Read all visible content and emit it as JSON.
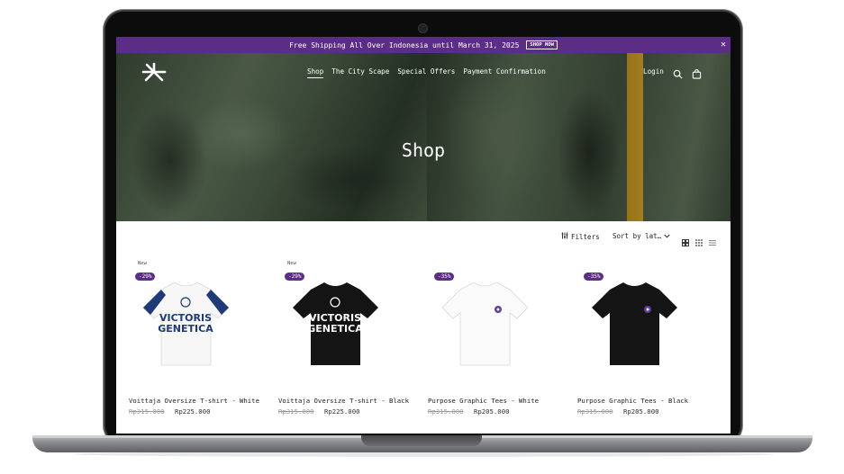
{
  "promo": {
    "text": "Free Shipping All Over Indonesia until March 31, 2025",
    "cta": "SHOP NOW",
    "close": "✕"
  },
  "nav": {
    "items": [
      "Shop",
      "The City Scape",
      "Special Offers",
      "Payment Confirmation"
    ],
    "login": "Login"
  },
  "hero": {
    "title": "Shop"
  },
  "toolbar": {
    "filters": "Filters",
    "sort": "Sort by lat…"
  },
  "products": [
    {
      "badge_new": "New",
      "discount": "-29%",
      "name": "Voittaja Oversize T-shirt - White",
      "old_price": "Rp315.000",
      "price": "Rp225.000",
      "color": "white",
      "print": [
        "VICTORIS",
        "GENETICA"
      ]
    },
    {
      "badge_new": "New",
      "discount": "-29%",
      "name": "Voittaja Oversize T-shirt - Black",
      "old_price": "Rp315.000",
      "price": "Rp225.000",
      "color": "black",
      "print": [
        "VICTORIS",
        "GENETICA"
      ]
    },
    {
      "badge_new": "",
      "discount": "-35%",
      "name": "Purpose Graphic Tees - White",
      "old_price": "Rp315.000",
      "price": "Rp205.000",
      "color": "white",
      "print": []
    },
    {
      "badge_new": "",
      "discount": "-35%",
      "name": "Purpose Graphic Tees - Black",
      "old_price": "Rp315.000",
      "price": "Rp205.000",
      "color": "black",
      "print": []
    }
  ],
  "colors": {
    "promo_bg": "#5c2d86",
    "badge_bg": "#5c2d86",
    "accent_stripe": "#1e3a78"
  },
  "icons": [
    "brand-logo-icon",
    "search-icon",
    "cart-icon",
    "filter-icon",
    "chevron-down-icon",
    "grid-2-icon",
    "grid-3-icon",
    "list-icon"
  ]
}
